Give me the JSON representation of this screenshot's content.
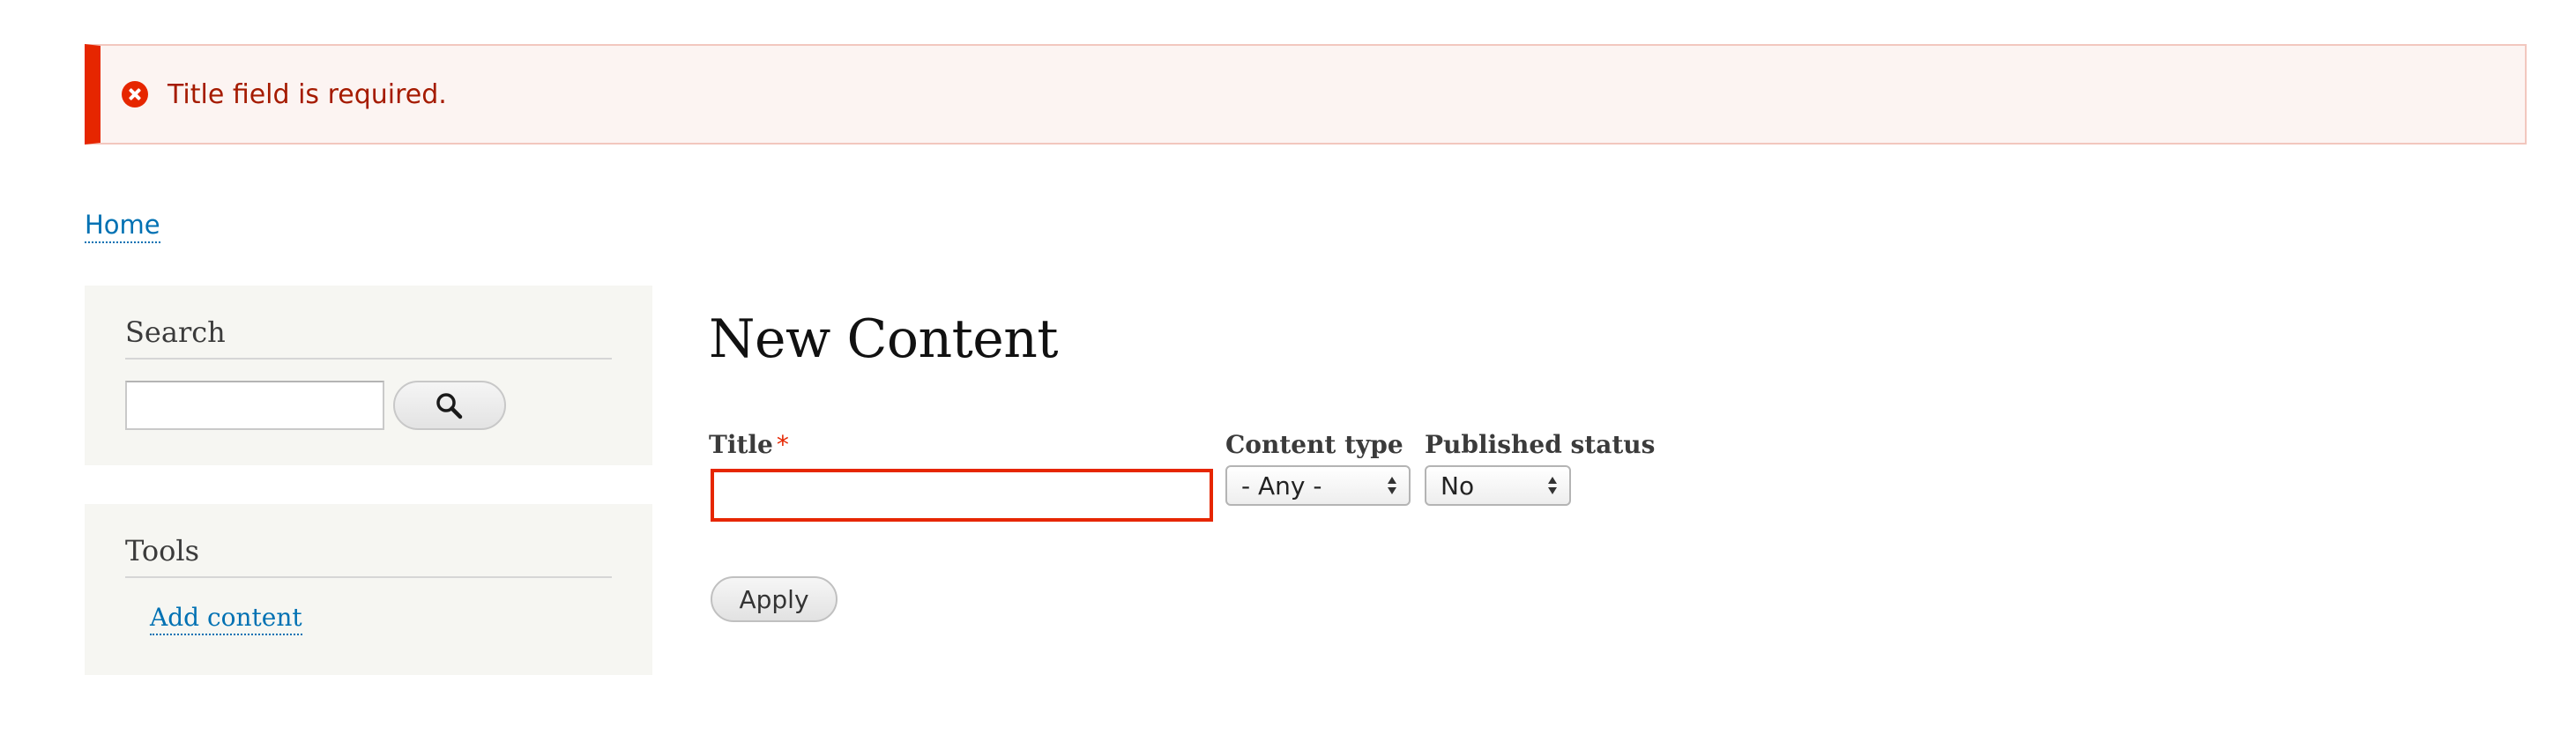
{
  "messages": {
    "error_text": "Title field is required.",
    "icon": "error-icon"
  },
  "breadcrumb": {
    "home_label": "Home"
  },
  "sidebar": {
    "search_block": {
      "title": "Search",
      "input_value": "",
      "button_icon": "search-icon"
    },
    "tools_block": {
      "title": "Tools",
      "links": [
        "Add content"
      ]
    }
  },
  "main": {
    "page_title": "New Content",
    "filters": {
      "title_label": "Title",
      "required_marker": "*",
      "title_value": "",
      "content_type_label": "Content type",
      "content_type_value": "- Any -",
      "published_status_label": "Published status",
      "published_status_value": "No"
    },
    "apply_label": "Apply"
  },
  "colors": {
    "error_accent": "#e62600",
    "error_text": "#a51b00",
    "error_background": "#fcf4f2",
    "link": "#0071b3",
    "sidebar_background": "#f6f6f2"
  }
}
